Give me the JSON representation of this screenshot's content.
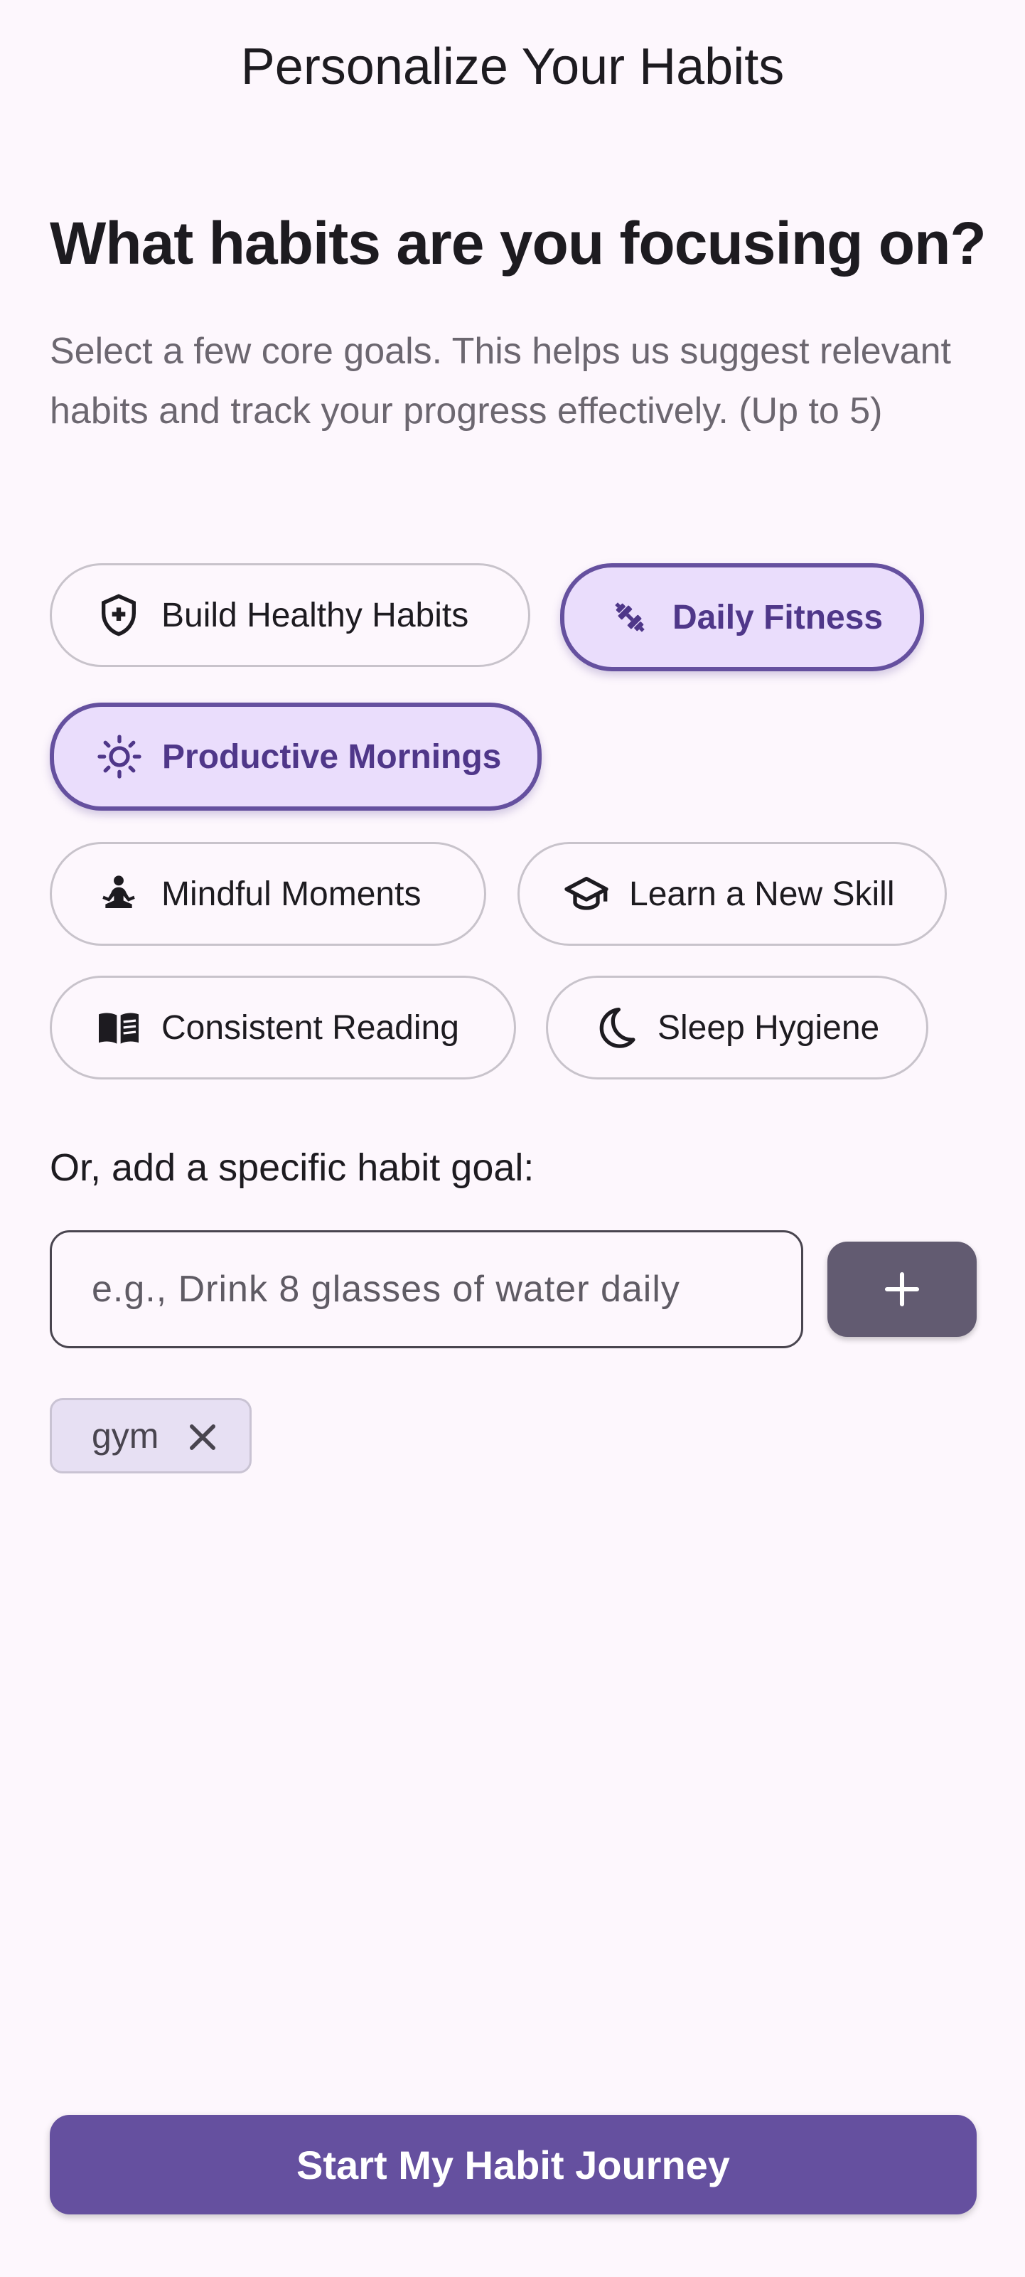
{
  "app_bar": {
    "title": "Personalize Your Habits"
  },
  "intro": {
    "heading": "What habits are you focusing on?",
    "subtitle": "Select a few core goals. This helps us suggest relevant habits and track your progress effectively. (Up to 5)"
  },
  "goal_chips": [
    {
      "label": "Build Healthy Habits",
      "icon": "shield-plus-icon",
      "selected": false
    },
    {
      "label": "Daily Fitness",
      "icon": "dumbbell-icon",
      "selected": true
    },
    {
      "label": "Productive Mornings",
      "icon": "sun-icon",
      "selected": true
    },
    {
      "label": "Mindful Moments",
      "icon": "meditation-icon",
      "selected": false
    },
    {
      "label": "Learn a New Skill",
      "icon": "graduation-cap-icon",
      "selected": false
    },
    {
      "label": "Consistent Reading",
      "icon": "book-icon",
      "selected": false
    },
    {
      "label": "Sleep Hygiene",
      "icon": "moon-icon",
      "selected": false
    }
  ],
  "custom_goal": {
    "label": "Or, add a specific habit goal:",
    "input_value": "",
    "placeholder": "e.g., Drink 8 glasses of water daily",
    "add_icon": "plus-icon"
  },
  "custom_tags": [
    {
      "label": "gym",
      "icon": "close-icon"
    }
  ],
  "cta": {
    "label": "Start My Habit Journey"
  },
  "colors": {
    "background": "#FDF7FD",
    "primary": "#65509F",
    "selected_chip_bg": "#EADDFC",
    "add_button": "#625B71",
    "tag_bg": "#E7E0F3"
  }
}
